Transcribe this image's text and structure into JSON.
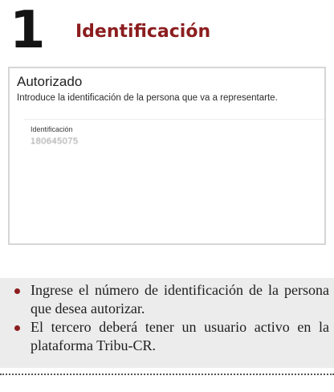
{
  "step": {
    "number": "1",
    "title": "Identificación"
  },
  "panel": {
    "title": "Autorizado",
    "instructions": "Introduce la identificación de la persona que va a representarte.",
    "field": {
      "label": "Identificación",
      "value": "180645075"
    }
  },
  "tips": [
    "Ingrese el número de identificación de la persona que desea autorizar.",
    "El tercero deberá tener un usuario activo en la plataforma Tribu-CR."
  ],
  "colors": {
    "accent": "#8c1d1f",
    "band": "#ececec"
  }
}
